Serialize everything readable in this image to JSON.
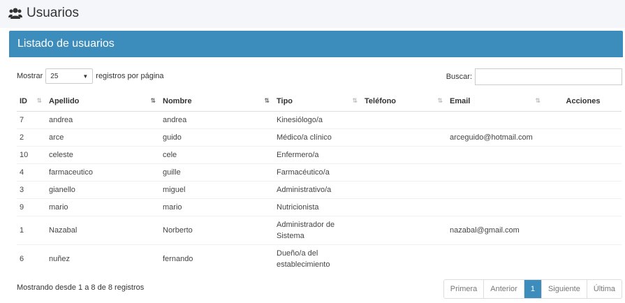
{
  "page": {
    "title": "Usuarios"
  },
  "panel": {
    "title": "Listado de usuarios"
  },
  "length": {
    "prefix": "Mostrar",
    "value": "25",
    "suffix": "registros por página"
  },
  "search": {
    "label": "Buscar:",
    "value": ""
  },
  "table": {
    "headers": [
      "ID",
      "Apellido",
      "Nombre",
      "Tipo",
      "Teléfono",
      "Email",
      "Acciones"
    ],
    "rows": [
      {
        "id": "7",
        "apellido": "andrea",
        "nombre": "andrea",
        "tipo": [
          "Kinesiólogo/a"
        ],
        "telefono": "",
        "email": ""
      },
      {
        "id": "2",
        "apellido": "arce",
        "nombre": "guido",
        "tipo": [
          "Médico/a clínico"
        ],
        "telefono": "",
        "email": "arceguido@hotmail.com"
      },
      {
        "id": "10",
        "apellido": "celeste",
        "nombre": "cele",
        "tipo": [
          "Enfermero/a"
        ],
        "telefono": "",
        "email": ""
      },
      {
        "id": "4",
        "apellido": "farmaceutico",
        "nombre": "guille",
        "tipo": [
          "Farmacéutico/a"
        ],
        "telefono": "",
        "email": ""
      },
      {
        "id": "3",
        "apellido": "gianello",
        "nombre": "miguel",
        "tipo": [
          "Administrativo/a"
        ],
        "telefono": "",
        "email": ""
      },
      {
        "id": "9",
        "apellido": "mario",
        "nombre": "mario",
        "tipo": [
          "Nutricionista"
        ],
        "telefono": "",
        "email": ""
      },
      {
        "id": "1",
        "apellido": "Nazabal",
        "nombre": "Norberto",
        "tipo": [
          "Administrador de",
          "Sistema"
        ],
        "telefono": "",
        "email": "nazabal@gmail.com"
      },
      {
        "id": "6",
        "apellido": "nuñez",
        "nombre": "fernando",
        "tipo": [
          "Dueño/a del",
          "establecimiento"
        ],
        "telefono": "",
        "email": ""
      }
    ]
  },
  "info": "Mostrando desde 1 a 8 de 8 registros",
  "pagination": [
    "Primera",
    "Anterior",
    "1",
    "Siguiente",
    "Última"
  ],
  "colors": {
    "primary": "#3c8dbc",
    "header_bg": "#f4f6f9"
  }
}
